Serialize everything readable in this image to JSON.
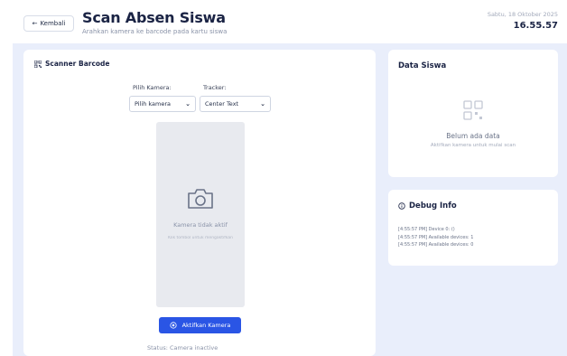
{
  "header": {
    "back_label": "Kembali",
    "title": "Scan Absen Siswa",
    "subtitle": "Arahkan kamera ke barcode pada kartu siswa",
    "date": "Sabtu, 18 Oktober 2025",
    "time": "16.55.57"
  },
  "scanner": {
    "title": "Scanner Barcode",
    "camera_label": "Pilih Kamera:",
    "camera_value": "Pilih kamera",
    "tracker_label": "Tracker:",
    "tracker_value": "Center Text",
    "camera_off": "Kamera tidak aktif",
    "camera_hint": "Klik tombol untuk mengaktifkan",
    "activate_label": "Aktifkan Kamera",
    "status": "Status: Camera inactive"
  },
  "student": {
    "title": "Data Siswa",
    "empty": "Belum ada data",
    "empty_hint": "Aktifkan kamera untuk mulai scan"
  },
  "debug": {
    "title": "Debug Info",
    "lines": [
      "[4:55:57 PM] Device 0: ()",
      "[4:55:57 PM] Available devices: 1",
      "[4:55:57 PM] Available devices: 0"
    ]
  },
  "colors": {
    "accent": "#2a55e5",
    "background": "#e9eefb",
    "title": "#1a2344"
  }
}
